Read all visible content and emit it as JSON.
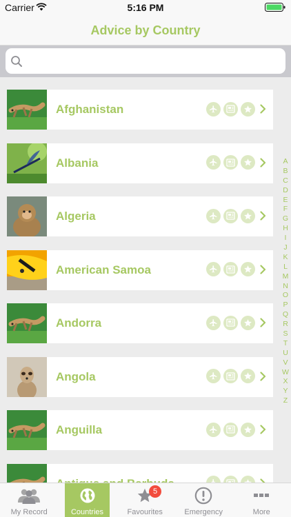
{
  "status_bar": {
    "carrier": "Carrier",
    "time": "5:16 PM"
  },
  "header": {
    "title": "Advice by Country"
  },
  "search": {
    "value": "",
    "placeholder": ""
  },
  "countries": [
    {
      "name": "Afghanistan",
      "thumb": "lizard"
    },
    {
      "name": "Albania",
      "thumb": "damselfly"
    },
    {
      "name": "Algeria",
      "thumb": "monkey"
    },
    {
      "name": "American Samoa",
      "thumb": "fish"
    },
    {
      "name": "Andorra",
      "thumb": "lizard"
    },
    {
      "name": "Angola",
      "thumb": "meerkat"
    },
    {
      "name": "Anguilla",
      "thumb": "lizard"
    },
    {
      "name": "Antigua and Barbuda",
      "thumb": "lizard"
    }
  ],
  "row_actions": [
    "plane-icon",
    "newspaper-icon",
    "star-icon",
    "chevron-right-icon"
  ],
  "index": [
    "A",
    "B",
    "C",
    "D",
    "E",
    "F",
    "G",
    "H",
    "I",
    "J",
    "K",
    "L",
    "M",
    "N",
    "O",
    "P",
    "Q",
    "R",
    "S",
    "T",
    "U",
    "V",
    "W",
    "X",
    "Y",
    "Z"
  ],
  "tabs": [
    {
      "label": "My Record",
      "icon": "people-icon",
      "active": false
    },
    {
      "label": "Countries",
      "icon": "globe-icon",
      "active": true
    },
    {
      "label": "Favourites",
      "icon": "star-icon",
      "active": false,
      "badge": "5"
    },
    {
      "label": "Emergency",
      "icon": "alert-icon",
      "active": false
    },
    {
      "label": "More",
      "icon": "more-icon",
      "active": false
    }
  ],
  "colors": {
    "accent": "#a6c862",
    "badge": "#f24c3d",
    "battery": "#4cd964"
  }
}
